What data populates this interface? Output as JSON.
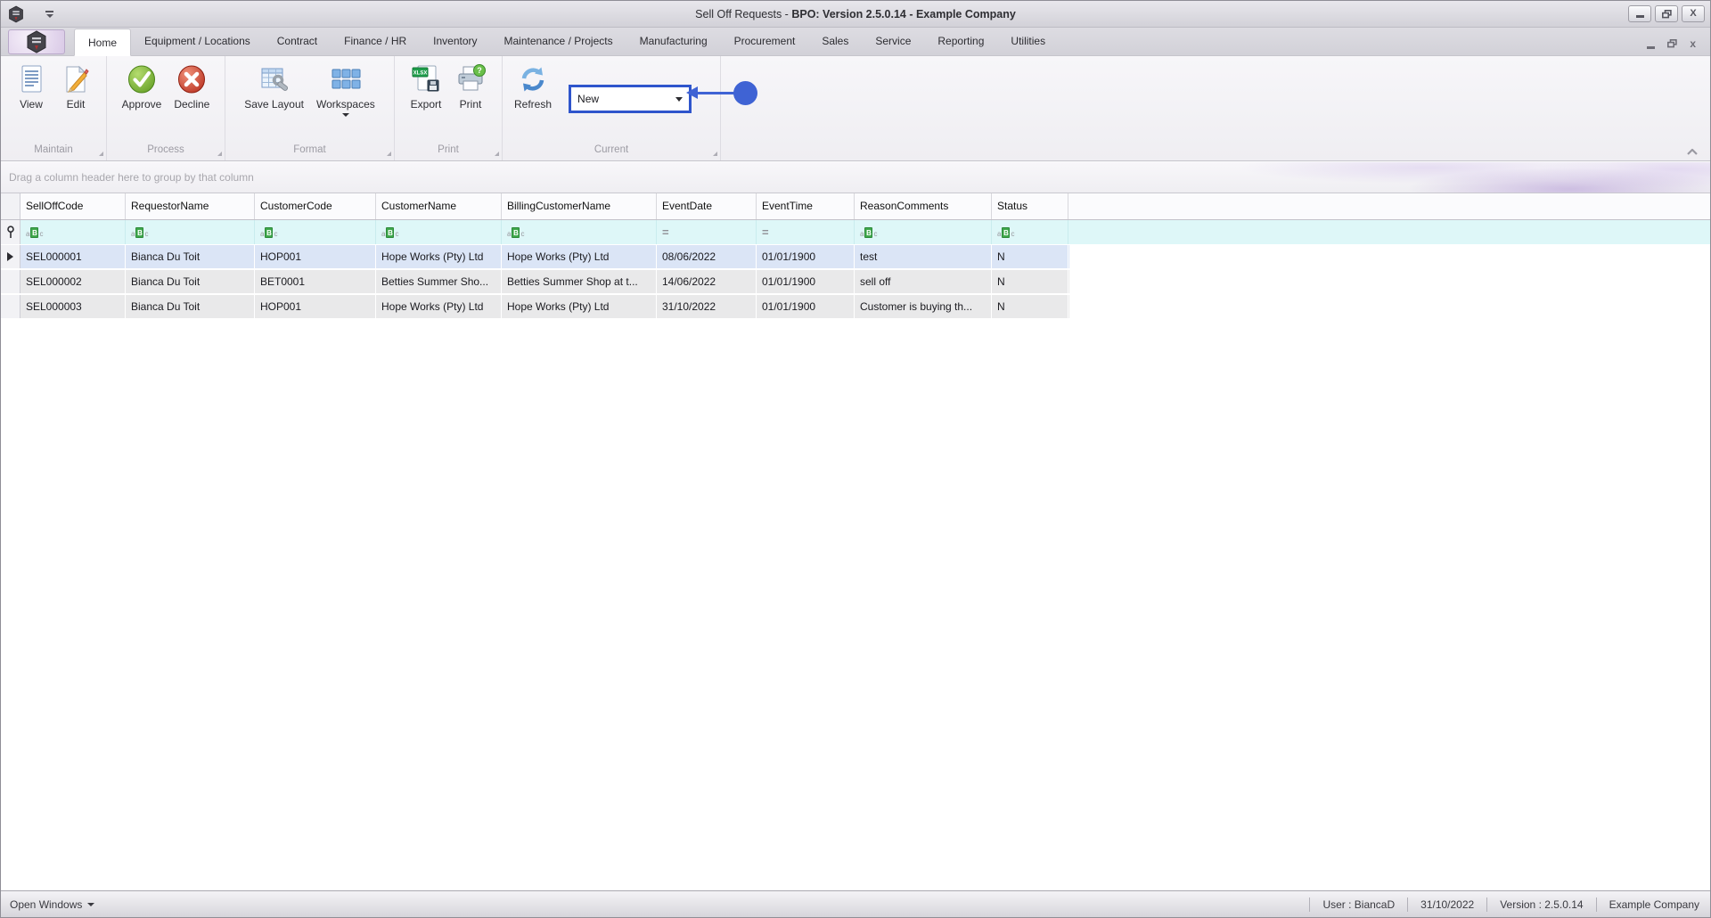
{
  "window": {
    "title_prefix": "Sell Off Requests - ",
    "title_main": "BPO: Version 2.5.0.14 - Example Company"
  },
  "tabs": {
    "active": "Home",
    "items": [
      "Home",
      "Equipment / Locations",
      "Contract",
      "Finance / HR",
      "Inventory",
      "Maintenance / Projects",
      "Manufacturing",
      "Procurement",
      "Sales",
      "Service",
      "Reporting",
      "Utilities"
    ]
  },
  "ribbon": {
    "buttons": {
      "view": "View",
      "edit": "Edit",
      "approve": "Approve",
      "decline": "Decline",
      "save_layout": "Save Layout",
      "workspaces": "Workspaces",
      "export": "Export",
      "print": "Print",
      "refresh": "Refresh"
    },
    "groups": [
      "Maintain",
      "Process",
      "Format",
      "Print",
      "Current"
    ],
    "current_filter_combo": {
      "value": "New"
    },
    "annotation": {
      "shape": "circle-with-arrow",
      "color": "#3f63d4",
      "target": "current-filter-combo"
    }
  },
  "grid": {
    "group_by_hint": "Drag a column header here to group by that column",
    "columns": [
      "SellOffCode",
      "RequestorName",
      "CustomerCode",
      "CustomerName",
      "BillingCustomerName",
      "EventDate",
      "EventTime",
      "ReasonComments",
      "Status"
    ],
    "filter_types": [
      "text",
      "text",
      "text",
      "text",
      "text",
      "date",
      "date",
      "text",
      "text"
    ],
    "rows": [
      {
        "selected": true,
        "cells": [
          "SEL000001",
          "Bianca Du Toit",
          "HOP001",
          "Hope Works (Pty) Ltd",
          "Hope Works (Pty) Ltd",
          "08/06/2022",
          "01/01/1900",
          "test",
          "N"
        ]
      },
      {
        "selected": false,
        "cells": [
          "SEL000002",
          "Bianca Du Toit",
          "BET0001",
          "Betties Summer Sho...",
          "Betties Summer Shop at t...",
          "14/06/2022",
          "01/01/1900",
          "sell off",
          "N"
        ]
      },
      {
        "selected": false,
        "cells": [
          "SEL000003",
          "Bianca Du Toit",
          "HOP001",
          "Hope Works (Pty) Ltd",
          "Hope Works (Pty) Ltd",
          "31/10/2022",
          "01/01/1900",
          "Customer is buying th...",
          "N"
        ]
      }
    ]
  },
  "statusbar": {
    "open_windows": "Open Windows",
    "user": "User : BiancaD",
    "date": "31/10/2022",
    "version": "Version : 2.5.0.14",
    "company": "Example Company"
  },
  "colors": {
    "annotation_blue": "#3f63d4",
    "combo_highlight_border": "#2f55cc",
    "selected_row_bg": "#dbe5f6",
    "filter_row_bg": "#def7f8",
    "approve_green": "#6aab2e",
    "decline_red": "#cc3a28",
    "filter_badge_green": "#3fa84c"
  },
  "icons": {
    "app": "bpo-logo-icon",
    "view": "document-icon",
    "edit": "pencil-page-icon",
    "approve": "green-check-icon",
    "decline": "red-x-icon",
    "save_layout": "table-wrench-icon",
    "workspaces": "tiles-grid-icon",
    "export": "xlsx-export-icon",
    "print": "printer-help-icon",
    "refresh": "circular-arrows-icon"
  }
}
